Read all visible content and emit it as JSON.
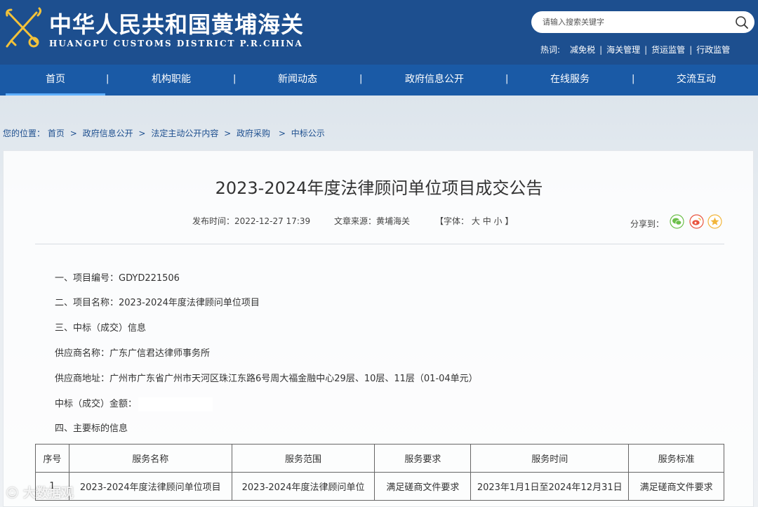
{
  "header": {
    "title_cn": "中华人民共和国黄埔海关",
    "title_en": "HUANGPU CUSTOMS DISTRICT P.R.CHINA",
    "search_placeholder": "请输入搜索关键字",
    "hot_label": "热词:",
    "hot_words": [
      "减免税",
      "海关管理",
      "货运监管",
      "行政监管"
    ]
  },
  "nav": {
    "items": [
      "首页",
      "机构职能",
      "新闻动态",
      "政府信息公开",
      "在线服务",
      "交流互动"
    ],
    "separator": "|"
  },
  "breadcrumb": {
    "prefix": "您的位置：",
    "items": [
      "首页",
      "政府信息公开",
      "法定主动公开内容",
      "政府采购",
      "中标公示"
    ],
    "arrow": ">"
  },
  "article": {
    "title": "2023-2024年度法律顾问单位项目成交公告",
    "publish_time": "发布时间：2022-12-27 17:39",
    "source": "文章来源：黄埔海关",
    "font_label_open": "【字体：",
    "font_sizes": [
      "大",
      "中",
      "小"
    ],
    "font_label_close": "】",
    "share_label": "分享到：",
    "paragraphs": [
      "一、项目编号：GDYD221506",
      "二、项目名称：2023-2024年度法律顾问单位项目",
      "三、中标（成交）信息",
      "供应商名称：广东广信君达律师事务所",
      "供应商地址：广州市广东省广州市天河区珠江东路6号周大福金融中心29层、10层、11层（01-04单元）",
      "中标（成交）金额：",
      "四、主要标的信息"
    ]
  },
  "table": {
    "headers": [
      "序号",
      "服务名称",
      "服务范围",
      "服务要求",
      "服务时间",
      "服务标准"
    ],
    "rows": [
      [
        "1",
        "2023-2024年度法律顾问单位项目",
        "2023-2024年度法律顾问单位",
        "满足磋商文件要求",
        "2023年1月1日至2024年12月31日",
        "满足磋商文件要求"
      ]
    ]
  },
  "watermark": "大数据观",
  "colors": {
    "header_bg": "#1d4f8f",
    "nav_bg": "#1a5aa6",
    "link": "#1d4f8f",
    "wechat": "#6cbf4a",
    "weibo": "#e8533e",
    "favorite": "#f2b53a"
  }
}
